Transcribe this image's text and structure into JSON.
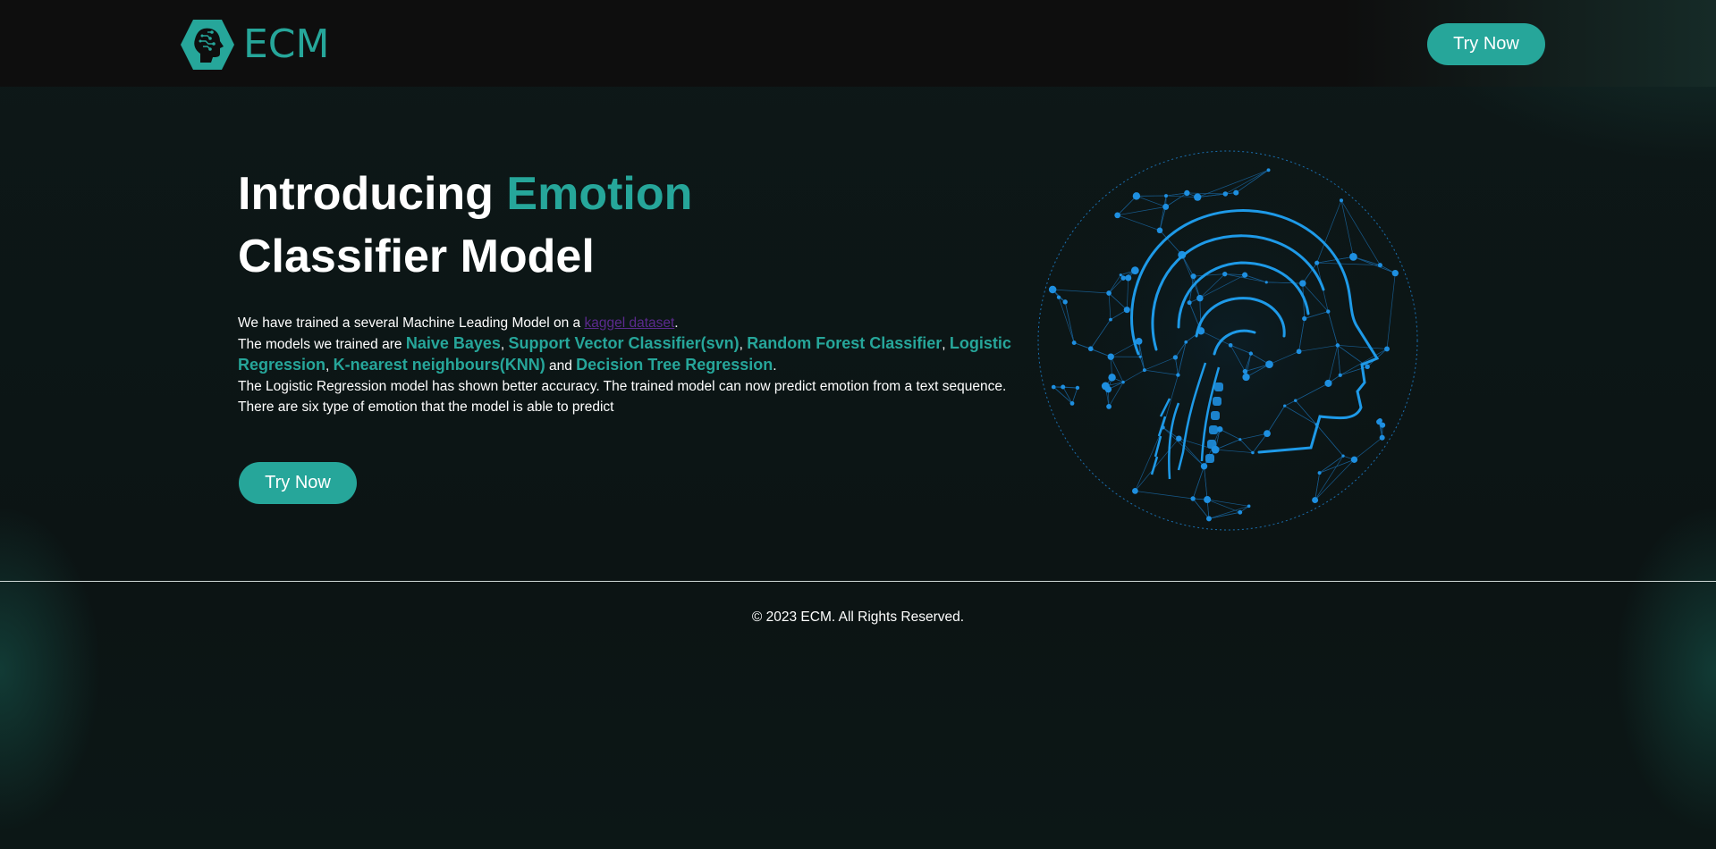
{
  "header": {
    "logo_text": "ECM",
    "logo_icon": "head-circuit-icon",
    "try_now_label": "Try Now"
  },
  "hero": {
    "title_part1": "Introducing ",
    "title_accent": "Emotion",
    "title_line2": "Classifier Model",
    "intro_text": "We have trained a several Machine Leading Model on a ",
    "dataset_link": "kaggel dataset",
    "intro_end": ".",
    "models_prefix": "The models we trained are ",
    "models": [
      "Naive Bayes",
      "Support Vector Classifier(svn)",
      "Random Forest Classifier",
      "Logistic Regression",
      "K-nearest neighbours(KNN)",
      "Decision Tree Regression"
    ],
    "sep_comma": ", ",
    "sep_and": " and ",
    "models_end": ".",
    "accuracy_text": "The Logistic Regression model has shown better accuracy. The trained model can now predict emotion from a text sequence.",
    "emotion_text": "There are six type of emotion that the model is able to predict",
    "try_now_label": "Try Now",
    "illustration": "brain-network-globe-icon"
  },
  "footer": {
    "copyright": "© 2023 ECM. All Rights Reserved."
  },
  "colors": {
    "accent": "#26a69a",
    "header_bg": "#0e0e0e",
    "page_bg": "#0c1414",
    "link": "#5b2a8e",
    "brain_blue": "#1e8fe0"
  }
}
